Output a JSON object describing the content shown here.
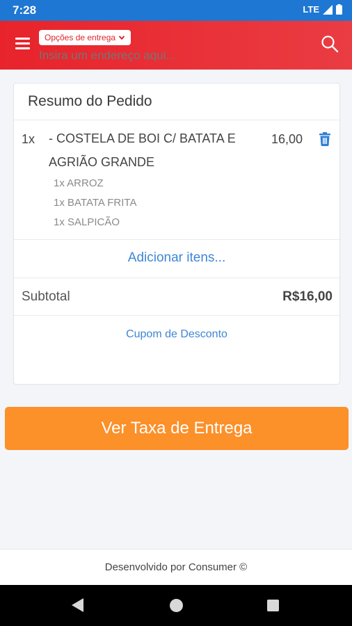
{
  "status_bar": {
    "time": "7:28",
    "network": "LTE"
  },
  "header": {
    "delivery_options_label": "Opções de entrega",
    "address_placeholder": "Insira um endereço aqui..."
  },
  "order_summary": {
    "title": "Resumo do Pedido",
    "items": [
      {
        "qty": "1x",
        "name": "- COSTELA DE BOI C/ BATATA E AGRIÃO GRANDE",
        "price": "16,00",
        "extras": [
          "1x ARROZ",
          "1x BATATA FRITA",
          "1x SALPICÃO"
        ]
      }
    ],
    "add_items_label": "Adicionar itens...",
    "subtotal_label": "Subtotal",
    "subtotal_value": "R$16,00",
    "coupon_label": "Cupom de Desconto"
  },
  "cta": {
    "label": "Ver Taxa de Entrega"
  },
  "footer": {
    "text": "Desenvolvido por Consumer ©"
  },
  "colors": {
    "status_bar": "#1e77d2",
    "header": "#e8232b",
    "link": "#3d86d6",
    "cta": "#fc9029"
  }
}
